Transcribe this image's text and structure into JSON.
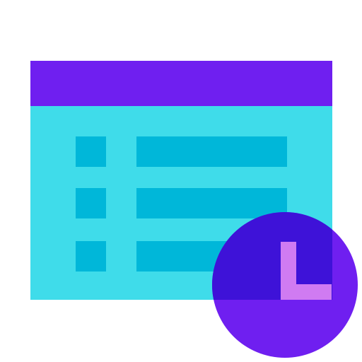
{
  "icon": {
    "name": "scheduled-list-icon",
    "colors": {
      "window_header": "#6F1FF0",
      "window_body": "#3FDCEA",
      "list_rows": "#00B7D9",
      "clock_face": "#6F1FF0",
      "clock_overlap": "#3E12D8",
      "clock_hands": "#D07BF2",
      "background": "#FFFFFF"
    },
    "list_item_count": 3
  }
}
